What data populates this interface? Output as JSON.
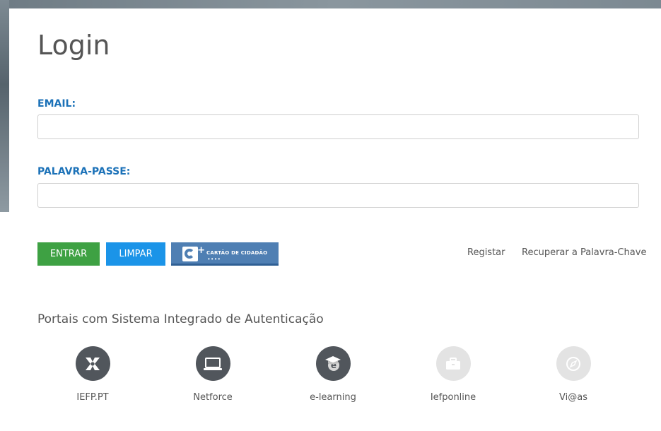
{
  "login": {
    "title": "Login",
    "email_label": "EMAIL:",
    "email_value": "",
    "password_label": "PALAVRA-PASSE:",
    "password_value": ""
  },
  "buttons": {
    "entrar": "ENTRAR",
    "limpar": "LIMPAR",
    "cartao_cidadao": "CARTÃO DE CIDADÃO",
    "cartao_dots": "••••"
  },
  "links": {
    "registar": "Registar",
    "recuperar": "Recuperar a Palavra-Chave"
  },
  "portals": {
    "title": "Portais com Sistema Integrado de Autenticação",
    "items": [
      {
        "label": "IEFP.PT",
        "icon": "iefp-logo-icon",
        "enabled": true
      },
      {
        "label": "Netforce",
        "icon": "laptop-icon",
        "enabled": true
      },
      {
        "label": "e-learning",
        "icon": "graduation-cap-e-icon",
        "enabled": true
      },
      {
        "label": "Iefponline",
        "icon": "briefcase-icon",
        "enabled": false
      },
      {
        "label": "Vi@as",
        "icon": "compass-icon",
        "enabled": false
      }
    ]
  },
  "colors": {
    "label_blue": "#1c72b8",
    "entrar_green": "#3ea143",
    "limpar_blue": "#1b94e8",
    "cc_blue": "#4f7fb3",
    "icon_dark": "#51565c",
    "icon_light": "#e3e3e3"
  }
}
